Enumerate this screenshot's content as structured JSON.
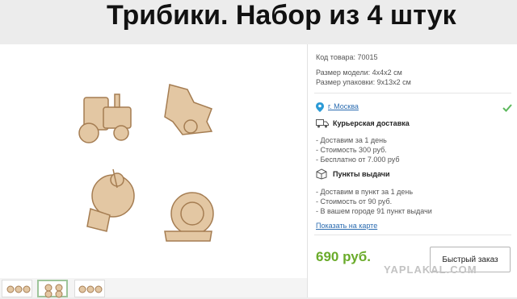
{
  "page": {
    "title": "Трибики. Набор из 4 штук"
  },
  "product": {
    "sku": "Код товара: 70015",
    "model_size": "Размер модели: 4x4x2 см",
    "package_size": "Размер упаковки: 9x13x2 см",
    "city": "г. Москва",
    "courier": {
      "title": "Курьерская доставка",
      "items": [
        "- Доставим за 1 день",
        "- Стоимость 300 руб.",
        "- Бесплатно от 7.000 руб"
      ]
    },
    "pickup": {
      "title": "Пункты выдачи",
      "items": [
        "- Доставим в пункт за 1 день",
        "- Стоимость от 90 руб.",
        "- В вашем городе 91 пункт выдачи"
      ]
    },
    "map_link": "Показать на карте",
    "price": "690 руб.",
    "buy_button": "Быстрый заказ"
  },
  "watermark": "YAPLAKAL.COM",
  "colors": {
    "price": "#6aab2a",
    "link": "#2a6bb0",
    "check": "#5cb85c",
    "wood": "#e3c7a3"
  },
  "icons": [
    "location-pin-icon",
    "check-icon",
    "truck-icon",
    "box-icon"
  ]
}
